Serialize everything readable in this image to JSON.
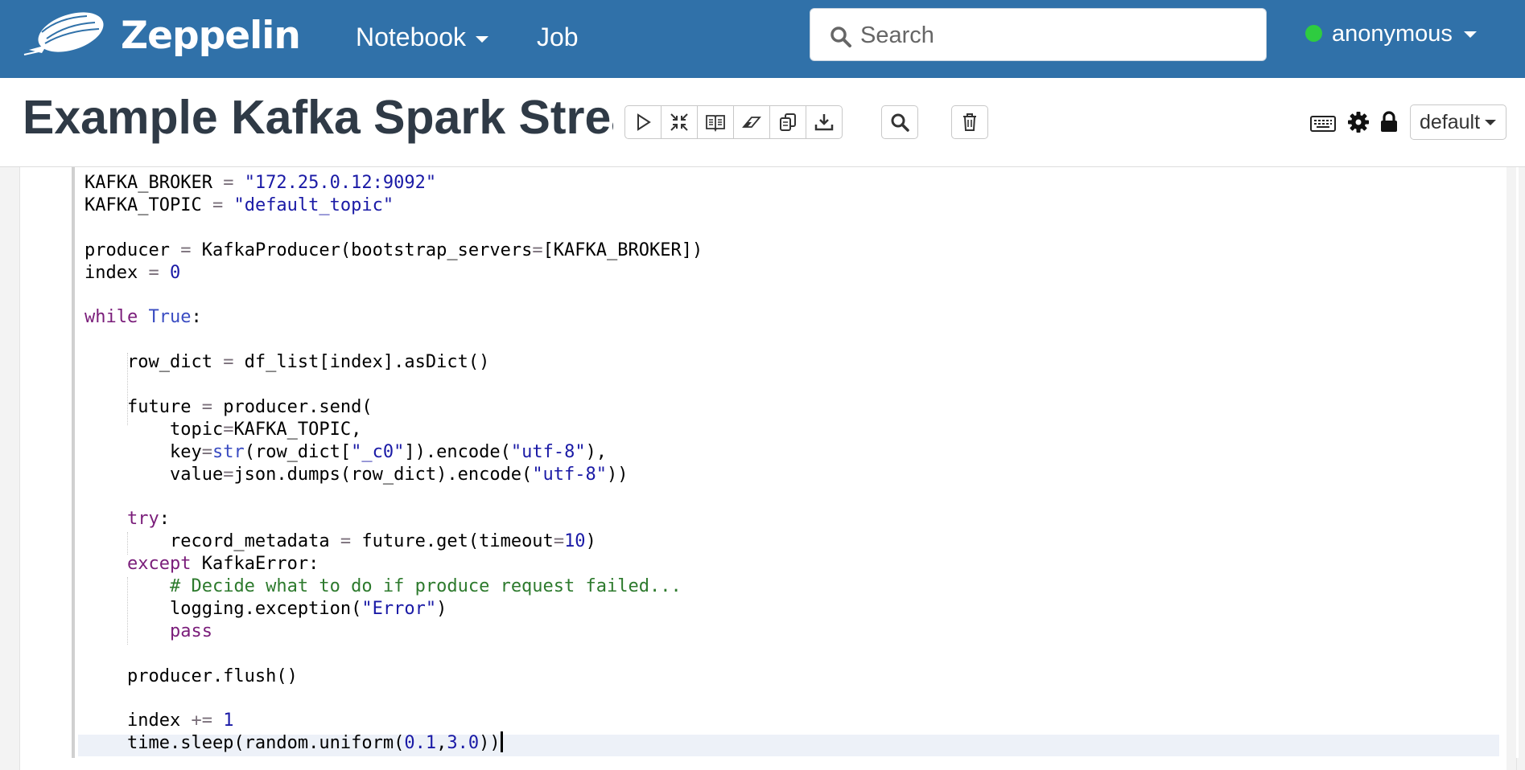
{
  "navbar": {
    "brand": "Zeppelin",
    "notebook_menu": "Notebook",
    "job_link": "Job",
    "search_placeholder": "Search",
    "user_name": "anonymous",
    "status_color": "#2ecc40",
    "bg_color": "#3071a9"
  },
  "notebook": {
    "title": "Example Kafka Spark Stream",
    "toolbar_icons": [
      "run-all-icon",
      "hide-code-icon",
      "hide-output-icon",
      "clear-output-icon",
      "clone-icon",
      "export-icon",
      "search-code-icon",
      "delete-icon"
    ],
    "right_icons": [
      "keyboard-icon",
      "settings-gear-icon",
      "lock-icon"
    ],
    "interpreter_binding": "default"
  },
  "editor": {
    "lines": [
      {
        "tokens": [
          [
            "",
            "KAFKA_BROKER "
          ],
          [
            "o",
            "="
          ],
          [
            "",
            " "
          ],
          [
            "s",
            "\"172.25.0.12:9092\""
          ]
        ]
      },
      {
        "tokens": [
          [
            "",
            "KAFKA_TOPIC "
          ],
          [
            "o",
            "="
          ],
          [
            "",
            " "
          ],
          [
            "s",
            "\"default_topic\""
          ]
        ]
      },
      {
        "tokens": []
      },
      {
        "tokens": [
          [
            "",
            "producer "
          ],
          [
            "o",
            "="
          ],
          [
            "",
            " KafkaProducer(bootstrap_servers"
          ],
          [
            "o",
            "="
          ],
          [
            "",
            "[KAFKA_BROKER])"
          ]
        ]
      },
      {
        "tokens": [
          [
            "",
            "index "
          ],
          [
            "o",
            "="
          ],
          [
            "",
            " "
          ],
          [
            "n",
            "0"
          ]
        ]
      },
      {
        "tokens": []
      },
      {
        "tokens": [
          [
            "k",
            "while"
          ],
          [
            "",
            " "
          ],
          [
            "b",
            "True"
          ],
          [
            "",
            ":"
          ]
        ]
      },
      {
        "tokens": []
      },
      {
        "tokens": [
          [
            "",
            "    row_dict "
          ],
          [
            "o",
            "="
          ],
          [
            "",
            " df_list[index].asDict()"
          ]
        ]
      },
      {
        "tokens": []
      },
      {
        "tokens": [
          [
            "",
            "    future "
          ],
          [
            "o",
            "="
          ],
          [
            "",
            " producer.send("
          ]
        ]
      },
      {
        "tokens": [
          [
            "",
            "        topic"
          ],
          [
            "o",
            "="
          ],
          [
            "",
            "KAFKA_TOPIC,"
          ]
        ]
      },
      {
        "tokens": [
          [
            "",
            "        key"
          ],
          [
            "o",
            "="
          ],
          [
            "b",
            "str"
          ],
          [
            "",
            "(row_dict["
          ],
          [
            "s",
            "\"_c0\""
          ],
          [
            "",
            "]).encode("
          ],
          [
            "s",
            "\"utf-8\""
          ],
          [
            "",
            "),"
          ]
        ]
      },
      {
        "tokens": [
          [
            "",
            "        value"
          ],
          [
            "o",
            "="
          ],
          [
            "",
            "json.dumps(row_dict).encode("
          ],
          [
            "s",
            "\"utf-8\""
          ],
          [
            "",
            "))"
          ]
        ]
      },
      {
        "tokens": []
      },
      {
        "tokens": [
          [
            "",
            "    "
          ],
          [
            "k",
            "try"
          ],
          [
            "",
            ":"
          ]
        ]
      },
      {
        "tokens": [
          [
            "",
            "        record_metadata "
          ],
          [
            "o",
            "="
          ],
          [
            "",
            " future.get(timeout"
          ],
          [
            "o",
            "="
          ],
          [
            "n",
            "10"
          ],
          [
            "",
            ")"
          ]
        ]
      },
      {
        "tokens": [
          [
            "",
            "    "
          ],
          [
            "k",
            "except"
          ],
          [
            "",
            " KafkaError:"
          ]
        ]
      },
      {
        "tokens": [
          [
            "",
            "        "
          ],
          [
            "c",
            "# Decide what to do if produce request failed..."
          ]
        ]
      },
      {
        "tokens": [
          [
            "",
            "        logging.exception("
          ],
          [
            "s",
            "\"Error\""
          ],
          [
            "",
            ")"
          ]
        ]
      },
      {
        "tokens": [
          [
            "",
            "        "
          ],
          [
            "k",
            "pass"
          ]
        ]
      },
      {
        "tokens": []
      },
      {
        "tokens": [
          [
            "",
            "    producer.flush()"
          ]
        ]
      },
      {
        "tokens": []
      },
      {
        "tokens": [
          [
            "",
            "    index "
          ],
          [
            "o",
            "+="
          ],
          [
            "",
            " "
          ],
          [
            "n",
            "1"
          ]
        ]
      },
      {
        "tokens": [
          [
            "",
            "    time.sleep(random.uniform("
          ],
          [
            "n",
            "0.1"
          ],
          [
            "",
            ","
          ],
          [
            "n",
            "3.0"
          ],
          [
            "",
            "))"
          ]
        ],
        "cursor": true
      }
    ]
  }
}
